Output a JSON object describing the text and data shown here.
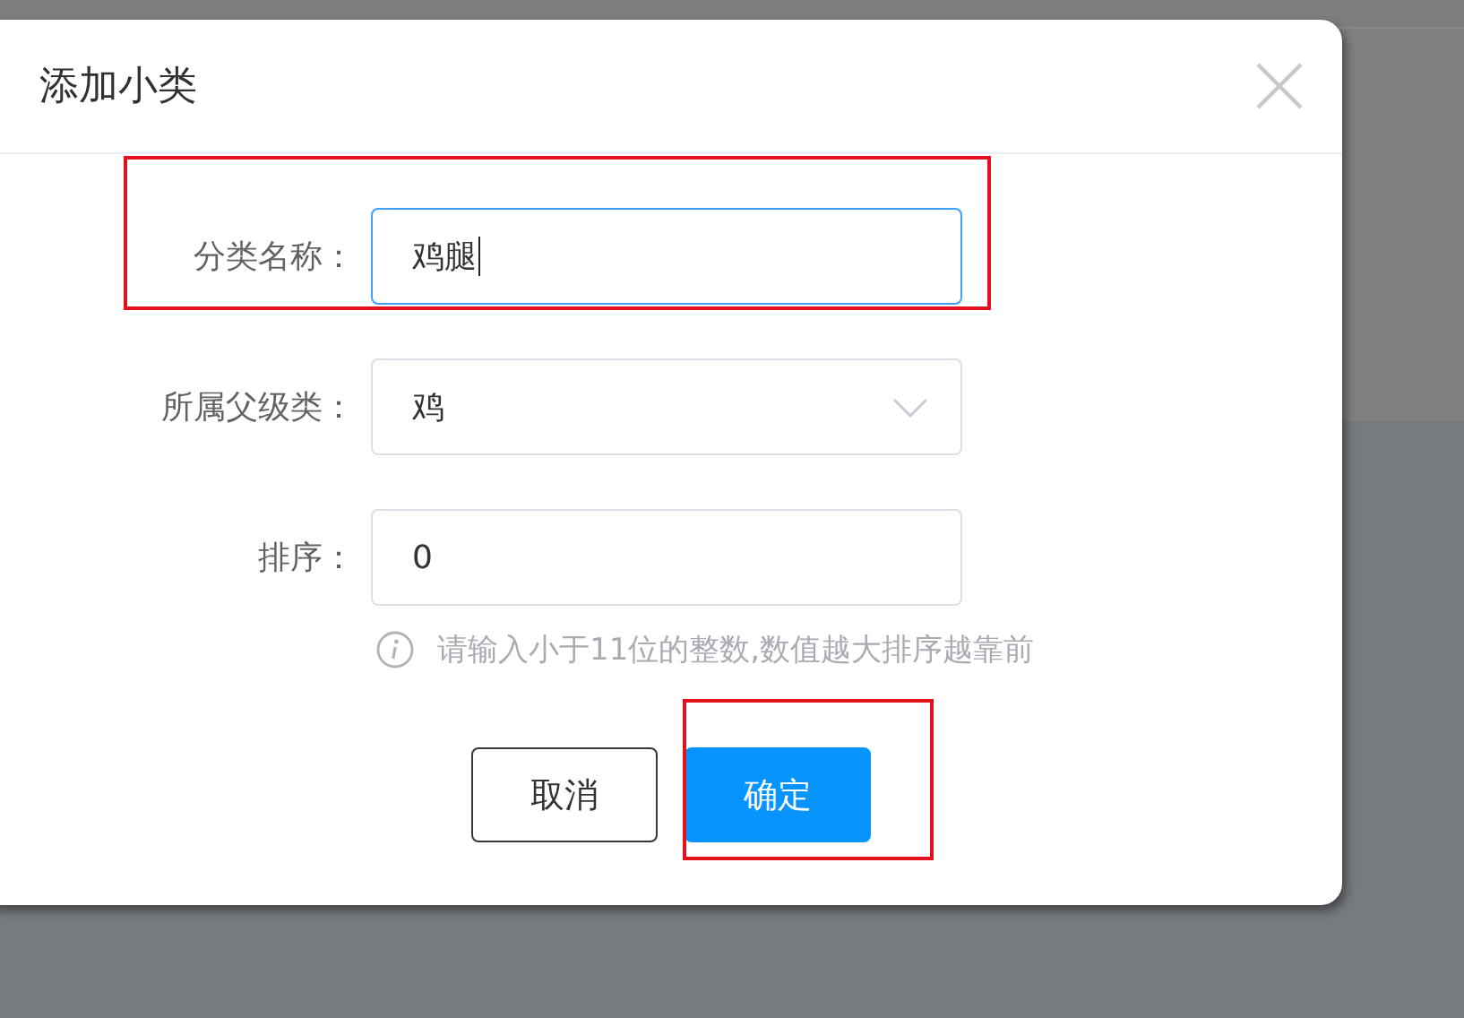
{
  "dialog": {
    "title": "添加小类"
  },
  "fields": [
    {
      "kind": "text",
      "label": "分类名称：",
      "value": "鸡腿",
      "focused": true,
      "highlighted": true
    },
    {
      "kind": "select",
      "label": "所属父级类：",
      "value": "鸡",
      "focused": false,
      "highlighted": false
    },
    {
      "kind": "text",
      "label": "排序：",
      "value": "0",
      "focused": false,
      "highlighted": false
    }
  ],
  "hint": "请输入小于11位的整数,数值越大排序越靠前",
  "buttons": [
    {
      "kind": "secondary",
      "label": "取消",
      "highlighted": false
    },
    {
      "kind": "primary",
      "label": "确定",
      "highlighted": true
    }
  ]
}
